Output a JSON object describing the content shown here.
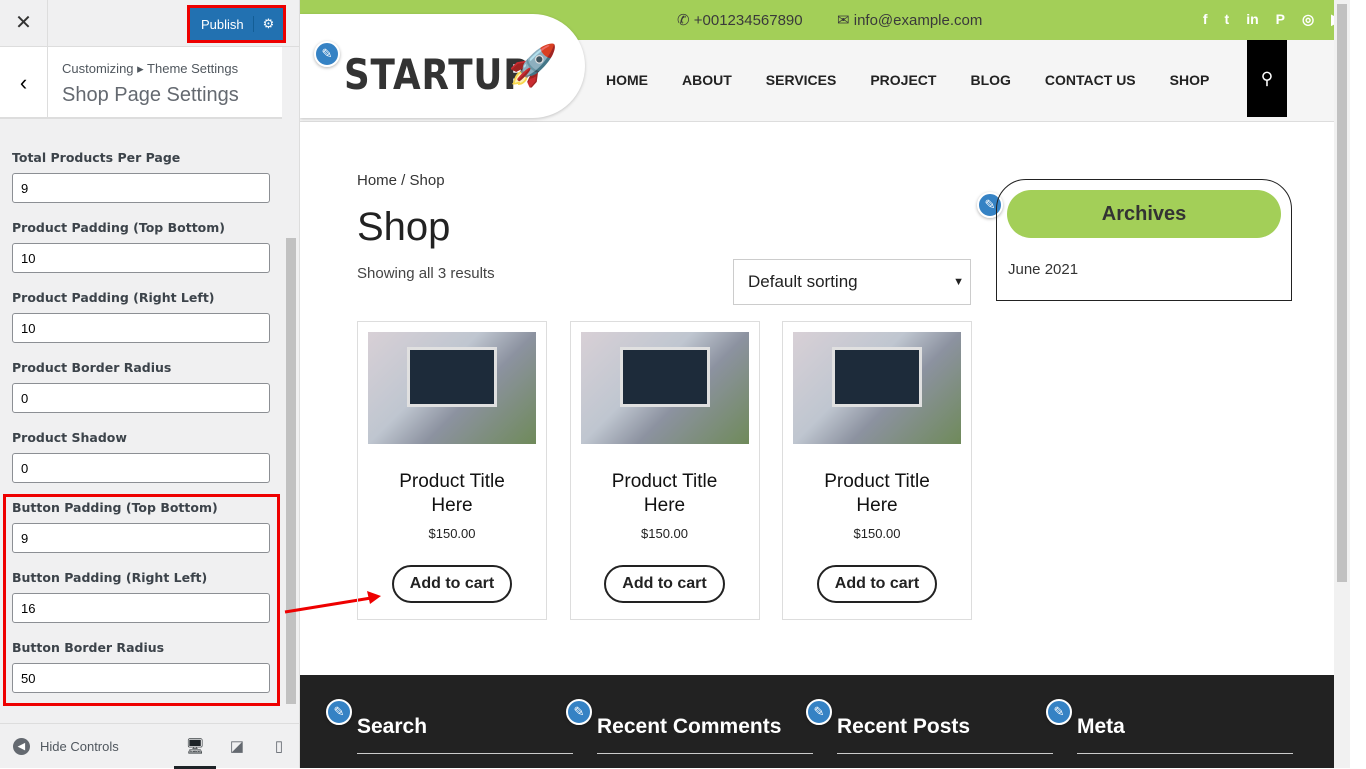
{
  "panel": {
    "close": "✕",
    "publish": "Publish",
    "crumb": "Customizing ▸ Theme Settings",
    "title": "Shop Page Settings",
    "fields": [
      {
        "label": "Total Products Per Page",
        "value": "9"
      },
      {
        "label": "Product Padding (Top Bottom)",
        "value": "10"
      },
      {
        "label": "Product Padding (Right Left)",
        "value": "10"
      },
      {
        "label": "Product Border Radius",
        "value": "0"
      },
      {
        "label": "Product Shadow",
        "value": "0"
      },
      {
        "label": "Button Padding (Top Bottom)",
        "value": "9"
      },
      {
        "label": "Button Padding (Right Left)",
        "value": "16"
      },
      {
        "label": "Button Border Radius",
        "value": "50"
      }
    ],
    "hide_controls": "Hide Controls"
  },
  "site": {
    "phone": "+001234567890",
    "email": "info@example.com",
    "logo": "STARTUP",
    "menu": [
      "HOME",
      "ABOUT",
      "SERVICES",
      "PROJECT",
      "BLOG",
      "CONTACT US",
      "SHOP"
    ],
    "breadcrumb": "Home / Shop",
    "title": "Shop",
    "count": "Showing all 3 results",
    "sort": "Default sorting",
    "products": [
      {
        "title": "Product Title Here",
        "price": "$150.00",
        "button": "Add to cart"
      },
      {
        "title": "Product Title Here",
        "price": "$150.00",
        "button": "Add to cart"
      },
      {
        "title": "Product Title Here",
        "price": "$150.00",
        "button": "Add to cart"
      }
    ],
    "archives": {
      "title": "Archives",
      "item": "June 2021"
    },
    "footer": [
      "Search",
      "Recent Comments",
      "Recent Posts",
      "Meta"
    ],
    "colors": {
      "accent": "#a3cf58",
      "publish": "#2271b1",
      "highlight": "#ee0000"
    }
  }
}
